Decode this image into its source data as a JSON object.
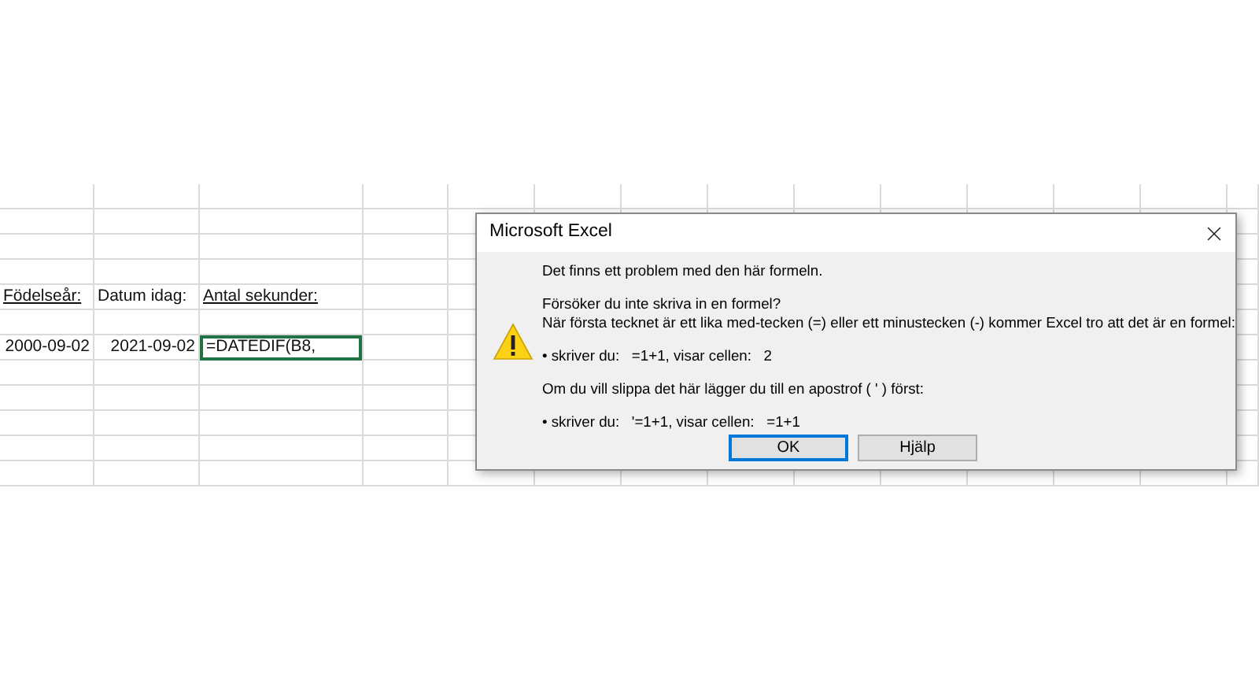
{
  "sheet": {
    "header_row": [
      {
        "text": "Födelseår:",
        "kind": "text",
        "underline": true,
        "selected": false
      },
      {
        "text": "Datum idag:",
        "kind": "text",
        "underline": false,
        "selected": false
      },
      {
        "text": "Antal sekunder:",
        "kind": "text",
        "underline": true,
        "selected": false
      }
    ],
    "data_row": [
      {
        "text": "2000-09-02",
        "kind": "date",
        "underline": false,
        "selected": false
      },
      {
        "text": "2021-09-02",
        "kind": "date",
        "underline": false,
        "selected": false
      },
      {
        "text": "=DATEDIF(B8,",
        "kind": "text",
        "underline": false,
        "selected": true
      }
    ]
  },
  "dialog": {
    "title": "Microsoft Excel",
    "paragraphs": [
      [
        "Det finns ett problem med den här formeln."
      ],
      [
        "Försöker du inte skriva in en formel?",
        "När första tecknet är ett lika med-tecken (=) eller ett minustecken (-) kommer Excel tro att det är en formel:"
      ],
      [
        "• skriver du:   =1+1, visar cellen:   2"
      ],
      [
        "Om du vill slippa det här lägger du till en apostrof ( ' ) först:"
      ],
      [
        "• skriver du:   '=1+1, visar cellen:   =1+1"
      ]
    ],
    "buttons": [
      {
        "label": "OK",
        "default": true
      },
      {
        "label": "Hjälp",
        "default": false
      }
    ]
  }
}
